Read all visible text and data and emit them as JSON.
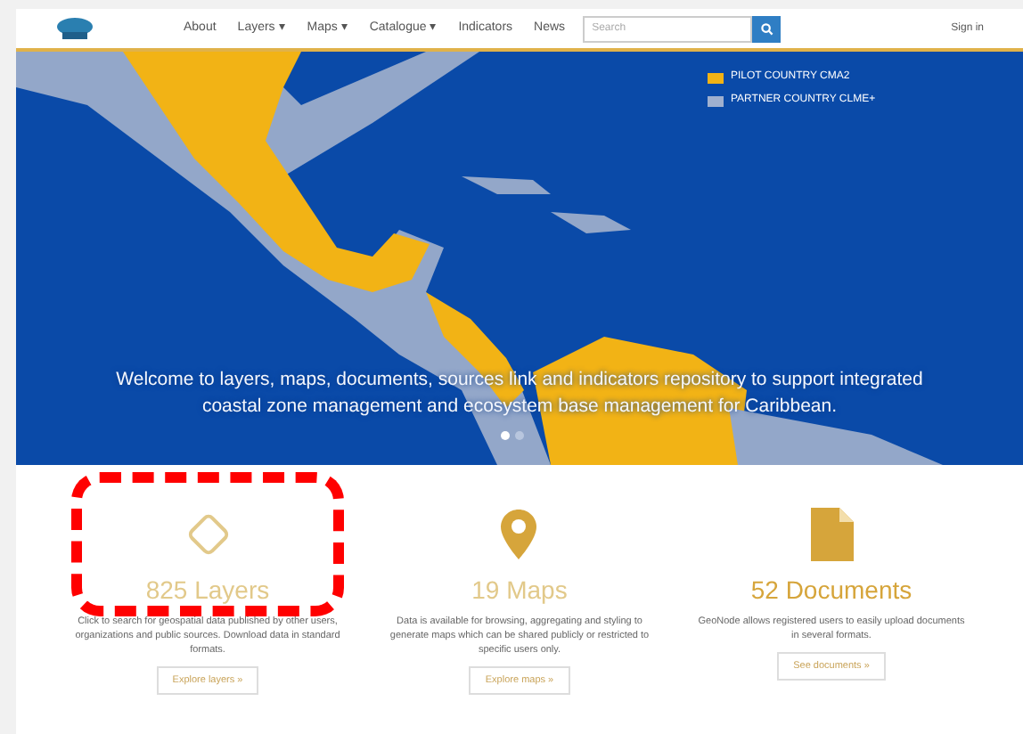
{
  "nav": {
    "items": [
      {
        "label": "About"
      },
      {
        "label": "Layers ▾"
      },
      {
        "label": "Maps ▾"
      },
      {
        "label": "Catalogue ▾"
      },
      {
        "label": "Indicators"
      },
      {
        "label": "News"
      }
    ],
    "search": {
      "placeholder": "Search"
    },
    "sign_in": "Sign in"
  },
  "hero": {
    "legend": [
      {
        "label": "PILOT COUNTRY CMA2",
        "color": "#f2b315"
      },
      {
        "label": "PARTNER COUNTRY CLME+",
        "color": "#9fb0cf"
      }
    ],
    "caption": "Welcome to layers, maps, documents, sources link and indicators repository to support integrated coastal zone management and ecosystem base management for Caribbean.",
    "dots": [
      {
        "selected": true
      },
      {
        "selected": false
      }
    ]
  },
  "cards": [
    {
      "kind": "layers",
      "highlighted": true,
      "title": "825 Layers",
      "text": "Click to search for geospatial data published by other users, organizations and public sources. Download data in standard formats.",
      "button": "Explore layers »"
    },
    {
      "kind": "maps",
      "highlighted": false,
      "title": "19 Maps",
      "text": "Data is available for browsing, aggregating and styling to generate maps which can be shared publicly or restricted to specific users only.",
      "button": "Explore maps »"
    },
    {
      "kind": "documents",
      "highlighted": false,
      "title": "52 Documents",
      "text": "GeoNode allows registered users to easily upload documents in several formats.",
      "button": "See documents »"
    }
  ]
}
